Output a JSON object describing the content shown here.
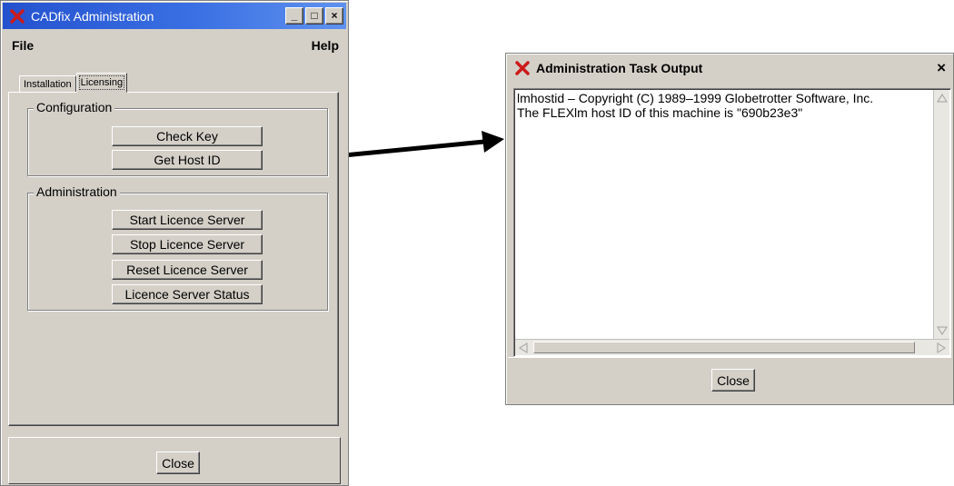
{
  "admin_window": {
    "title": "CADfix Administration",
    "title_buttons": [
      "_",
      "□",
      "×"
    ],
    "menu": {
      "file": "File",
      "help": "Help"
    },
    "tabs": [
      {
        "label": "Installation",
        "active": false
      },
      {
        "label": "Licensing",
        "active": true
      }
    ],
    "configuration": {
      "legend": "Configuration",
      "buttons": [
        "Check Key",
        "Get Host ID"
      ]
    },
    "administration": {
      "legend": "Administration",
      "buttons": [
        "Start Licence Server",
        "Stop Licence Server",
        "Reset Licence Server",
        "Licence Server Status"
      ]
    },
    "close_label": "Close"
  },
  "output_window": {
    "title": "Administration Task Output",
    "close_glyph": "×",
    "lines": [
      "lmhostid – Copyright (C) 1989–1999 Globetrotter Software, Inc.",
      "The FLEXlm host ID of this machine is \"690b23e3\""
    ],
    "close_label": "Close"
  },
  "icons": {
    "app": "x-logo-icon",
    "arrow": "arrow-right-icon"
  },
  "colors": {
    "titlebar_active": "#2452cf",
    "window_face": "#d4d0c8",
    "app_icon": "#cc1a1a"
  }
}
